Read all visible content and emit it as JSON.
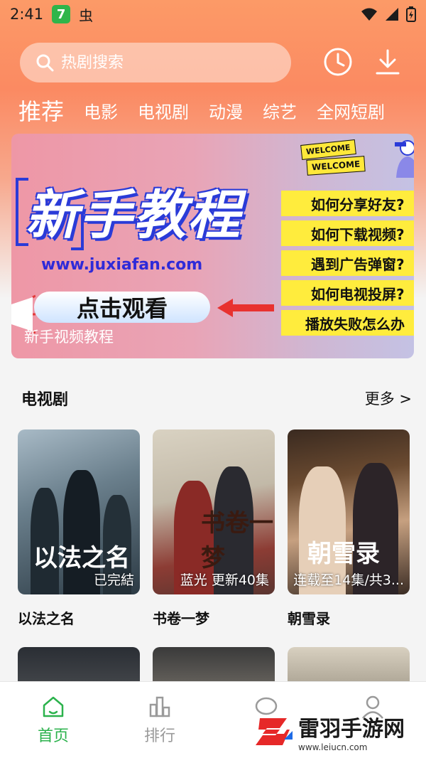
{
  "status_bar": {
    "time": "2:41",
    "app_badge": "7",
    "bug_glyph": "虫"
  },
  "search": {
    "placeholder": "热剧搜索"
  },
  "header_icons": [
    "history-clock-icon",
    "download-icon"
  ],
  "tabs": [
    {
      "label": "推荐",
      "active": true
    },
    {
      "label": "电影",
      "active": false
    },
    {
      "label": "电视剧",
      "active": false
    },
    {
      "label": "动漫",
      "active": false
    },
    {
      "label": "综艺",
      "active": false
    },
    {
      "label": "全网短剧",
      "active": false
    }
  ],
  "banner": {
    "title": "新手教程",
    "url": "www.juxiafan.com",
    "cta": "点击观看",
    "caption": "新手视频教程",
    "welcome_1": "WELCOME",
    "welcome_2": "WELCOME",
    "faq": [
      "如何分享好友?",
      "如何下载视频?",
      "遇到广告弹窗?",
      "如何电视投屏?",
      "播放失败怎么办"
    ]
  },
  "section": {
    "title": "电视剧",
    "more": "更多 >"
  },
  "shows": [
    {
      "title": "以法之名",
      "badge": "已完結",
      "poster_text": "以法之名"
    },
    {
      "title": "书卷一梦",
      "badge": "蓝光 更新40集",
      "poster_text": "书卷一梦"
    },
    {
      "title": "朝雪录",
      "badge": "连载至14集/共3...",
      "poster_text": "朝雪录"
    }
  ],
  "bottom_nav": [
    {
      "label": "首页",
      "icon": "home-icon",
      "active": true
    },
    {
      "label": "排行",
      "icon": "ranking-icon",
      "active": false
    },
    {
      "label": "",
      "icon": "chat-icon",
      "active": false
    },
    {
      "label": "",
      "icon": "user-icon",
      "active": false
    }
  ],
  "watermark": {
    "name": "雷羽手游网",
    "url": "www.leiucn.com"
  },
  "colors": {
    "accent_green": "#2bb24c",
    "header_orange": "#fb8a62",
    "faq_yellow": "#ffec3d",
    "url_blue": "#2f2ad8"
  }
}
